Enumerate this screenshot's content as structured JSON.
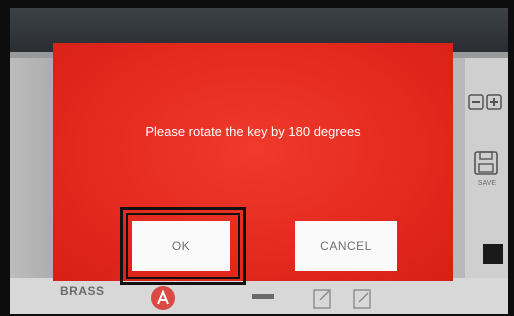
{
  "dialog": {
    "message": "Please rotate the key by 180 degrees",
    "ok_label": "OK",
    "cancel_label": "CANCEL"
  },
  "background": {
    "material_label": "BRASS",
    "save_label": "SAVE"
  },
  "colors": {
    "dialog_red": "#e52a1f",
    "button_white": "#fafafa",
    "highlight_border": "#111111"
  }
}
